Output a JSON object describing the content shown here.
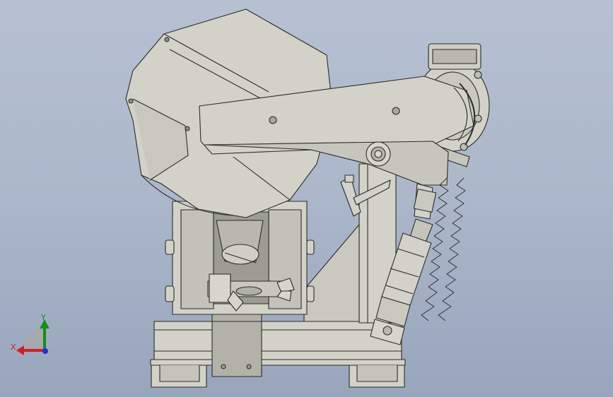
{
  "viewport": {
    "background_top": "#b6c0d2",
    "background_bottom": "#98a5bb",
    "part_fill": "#d2d2c8",
    "part_stroke": "#2c2c2c"
  },
  "triad": {
    "x_label": "X",
    "y_label": "Y",
    "x_color": "#d02020",
    "y_color": "#1a8a1a",
    "z_color": "#2030d0"
  }
}
